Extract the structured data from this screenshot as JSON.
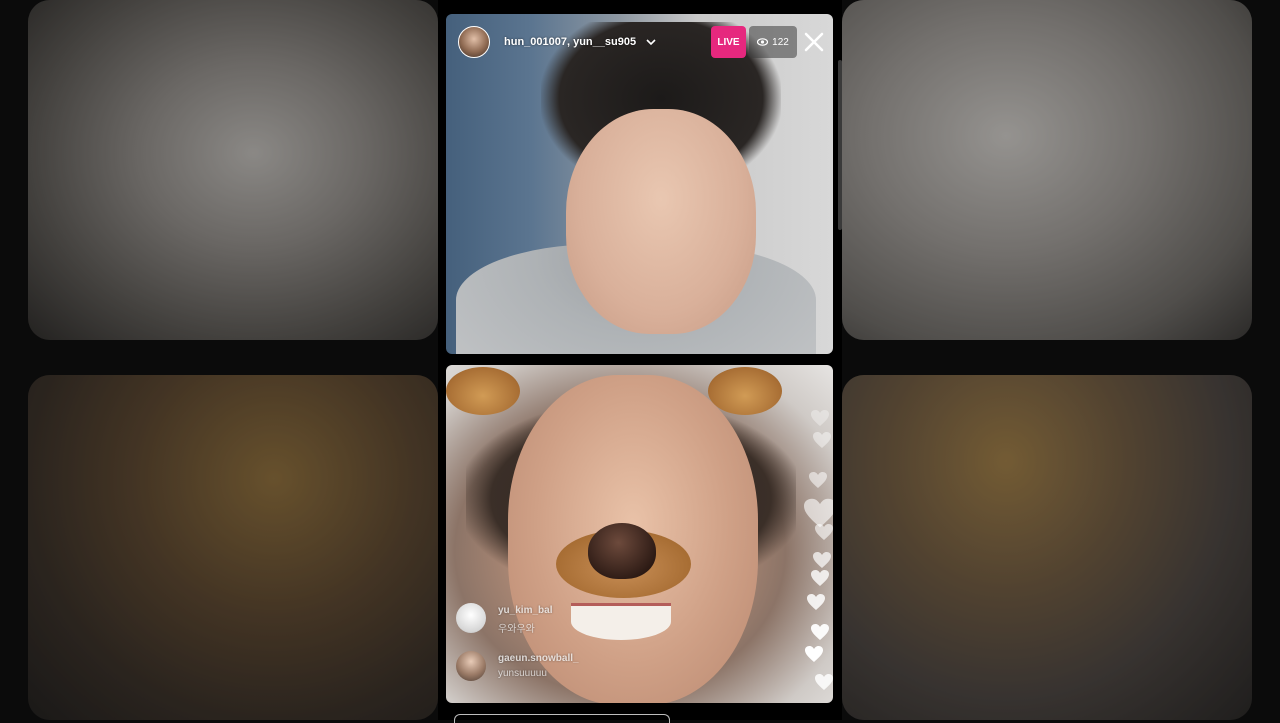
{
  "header": {
    "usernames": "hun_001007, yun__su905",
    "live_label": "LIVE",
    "viewer_count": "122"
  },
  "comments": [
    {
      "username": "yu_kim_bal",
      "text": "우와우와"
    },
    {
      "username": "gaeun.snowball_",
      "text": "yunsuuuuu"
    }
  ],
  "colors": {
    "live_badge": "#e6287e",
    "heart": "#ffffff"
  },
  "icons": {
    "close": "close-icon",
    "viewers": "eye-icon",
    "expand": "chevron-down-icon",
    "like": "heart-icon"
  }
}
